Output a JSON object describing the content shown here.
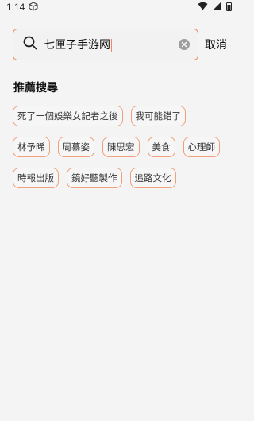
{
  "status_bar": {
    "time": "1:14",
    "icons": [
      "box-icon",
      "wifi-icon",
      "signal-icon",
      "battery-icon"
    ]
  },
  "search": {
    "value": "七匣子手游网",
    "clear_icon": "clear-circle-icon",
    "cancel_label": "取消"
  },
  "recommend": {
    "title": "推薦搜尋",
    "tags": [
      "死了一個娛樂女記者之後",
      "我可能錯了",
      "林予晞",
      "周慕姿",
      "陳思宏",
      "美食",
      "心理師",
      "時報出版",
      "鏡好聽製作",
      "追路文化"
    ]
  },
  "colors": {
    "accent": "#f08a5d",
    "tag_border": "#f0a07a",
    "background": "#f4f4f4"
  }
}
